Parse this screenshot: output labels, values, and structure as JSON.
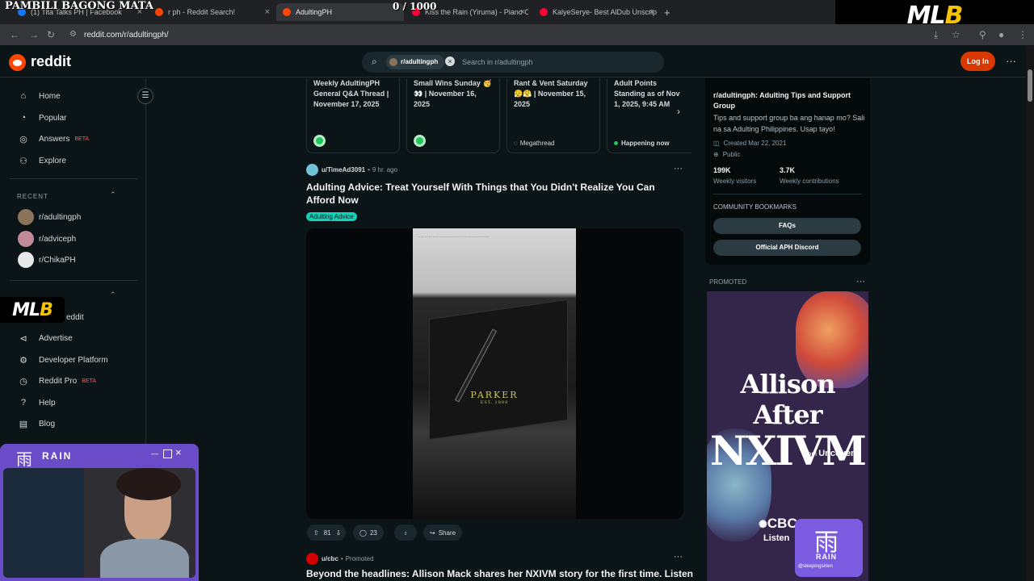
{
  "overlay": {
    "title": "PAMBILI BAGONG MATA",
    "counter": "0 / 1000",
    "mlb": "MLB"
  },
  "tabs": [
    {
      "label": "(1) Tita Talks PH | Facebook"
    },
    {
      "label": "r ph - Reddit Search!"
    },
    {
      "label": "AdultingPH"
    },
    {
      "label": "Kiss the Rain (Yiruma) - Piano C"
    },
    {
      "label": "KalyeSerye- Best AlDub Unscrip"
    }
  ],
  "address": {
    "url": "reddit.com/r/adultingph/"
  },
  "header": {
    "logo_text": "reddit",
    "search_chip": "r/adultingph",
    "search_placeholder": "Search in r/adultingph",
    "login": "Log In"
  },
  "sidebar": {
    "main": [
      {
        "label": "Home",
        "icon": "home-icon"
      },
      {
        "label": "Popular",
        "icon": "popular-icon"
      },
      {
        "label": "Answers",
        "icon": "answers-icon",
        "badge": "BETA"
      },
      {
        "label": "Explore",
        "icon": "explore-icon"
      }
    ],
    "recent_head": "RECENT",
    "recent": [
      {
        "label": "r/adultingph"
      },
      {
        "label": "r/adviceph"
      },
      {
        "label": "r/ChikaPH"
      }
    ],
    "resources_partial": "eddit",
    "resources": [
      {
        "label": "Advertise",
        "icon": "megaphone-icon"
      },
      {
        "label": "Developer Platform",
        "icon": "developer-icon"
      },
      {
        "label": "Reddit Pro",
        "icon": "pro-icon",
        "badge": "BETA"
      },
      {
        "label": "Help",
        "icon": "help-icon"
      },
      {
        "label": "Blog",
        "icon": "blog-icon"
      }
    ]
  },
  "highlights": [
    {
      "title": "Weekly AdultingPH General Q&A Thread | November 17, 2025",
      "footer": ""
    },
    {
      "title": "Small Wins Sunday 🥳👀 | November 16, 2025",
      "footer": ""
    },
    {
      "title": "Rant & Vent Saturday 😮‍💨😤 | November 15, 2025",
      "footer": "Megathread"
    },
    {
      "title": "Adult Points Standing as of Nov 1, 2025, 9:45 AM",
      "footer": "Happening now"
    }
  ],
  "post": {
    "author": "u/TimeAd3091",
    "time": "9 hr. ago",
    "title": "Adulting Advice: Treat Yourself With Things that You Didn't Realize You Can Afford Now",
    "flair": "Adulting Advice",
    "brand_text": "PARKER",
    "brand_sub": "EST. 1888",
    "score": "81",
    "comments": "23",
    "share": "Share"
  },
  "promoted_post": {
    "author": "u/cbc",
    "tag": "Promoted",
    "title": "Beyond the headlines: Allison Mack shares her NXIVM story for the first time. Listen"
  },
  "community": {
    "title": "r/adultingph: Adulting Tips and Support Group",
    "description": "Tips and support group ba ang hanap mo? Sali na sa Adulting Philippines. Usap tayo!",
    "created": "Created Mar 22, 2021",
    "visibility": "Public",
    "visitors": "199K",
    "visitors_label": "Weekly visitors",
    "contributions": "3.7K",
    "contributions_label": "Weekly contributions",
    "bookmarks_head": "COMMUNITY BOOKMARKS",
    "bookmarks": [
      "FAQs",
      "Official APH Discord"
    ]
  },
  "ad": {
    "label": "PROMOTED",
    "line1": "Allison After",
    "line2": "NXIVM",
    "from": "from",
    "brand": "Uncover",
    "cbc": "CBC",
    "listen": "Listen"
  },
  "webcam": {
    "brand": "RAIN",
    "glyph": "雨",
    "handle": "@sleepingsirien"
  }
}
